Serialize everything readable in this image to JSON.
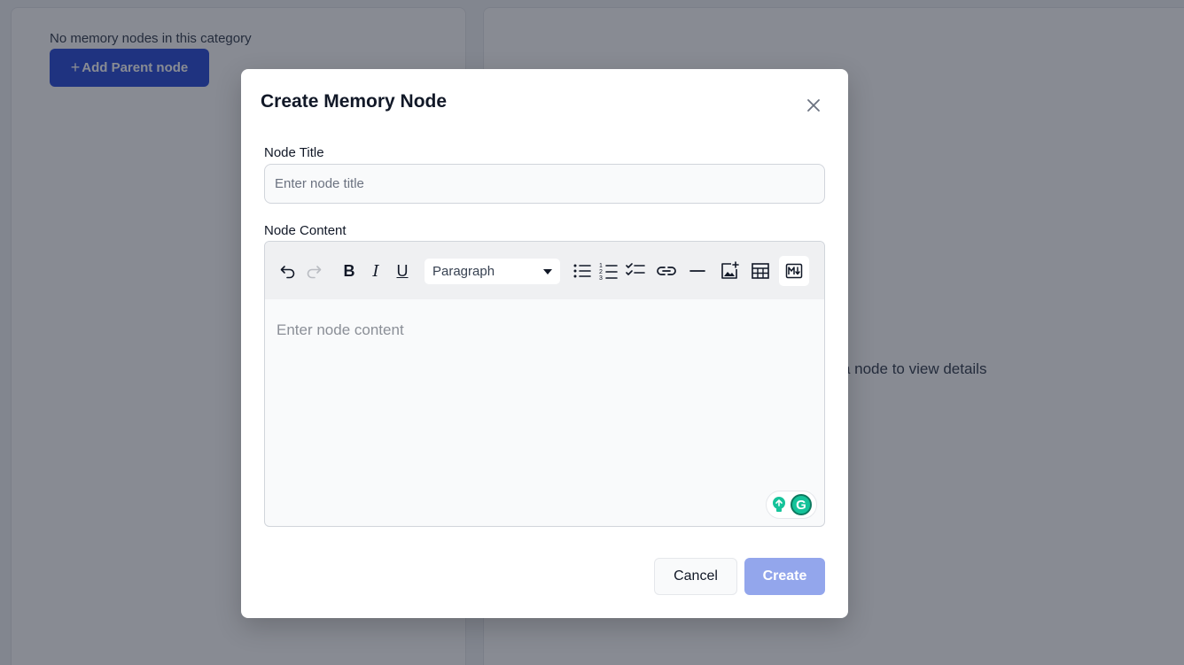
{
  "background": {
    "left_panel": {
      "empty_message": "No memory nodes in this category",
      "add_parent_button": "Add Parent node",
      "add_icon": "plus-icon"
    },
    "right_panel": {
      "empty_message": "Select a node to view details"
    }
  },
  "modal": {
    "title": "Create Memory Node",
    "close_icon": "close-icon",
    "node_title": {
      "label": "Node Title",
      "placeholder": "Enter node title",
      "value": ""
    },
    "node_content": {
      "label": "Node Content",
      "placeholder": "Enter node content",
      "toolbar": {
        "bold": "B",
        "italic": "I",
        "underline": "U",
        "block_type": "Paragraph",
        "icons": [
          "undo-icon",
          "redo-icon",
          "bold-icon",
          "italic-icon",
          "underline-icon",
          "bullet-list-icon",
          "numbered-list-icon",
          "checklist-icon",
          "link-icon",
          "horizontal-rule-icon",
          "insert-image-icon",
          "table-icon",
          "markdown-icon"
        ]
      }
    },
    "buttons": {
      "cancel": "Cancel",
      "create": "Create"
    }
  },
  "colors": {
    "primary": "#2d4fd8",
    "primary_disabled": "#93a6ec",
    "overlay": "rgba(17,24,39,0.5)"
  }
}
